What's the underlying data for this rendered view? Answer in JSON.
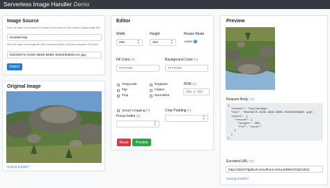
{
  "navbar": {
    "title": "Serverless Image Handler",
    "subtitle": "Demo"
  },
  "image_source": {
    "heading": "Image Source",
    "bucket_help": "Enter the name of an Amazon S3 bucket in your account that contains original image files.",
    "bucket_value": "bouldermap",
    "key_help": "Enter the name of an image file (with extension) stored in the above Amazon S3 bucket.",
    "key_value": "D6249275-AC6D-4B4D-B4BC-E833093EBAAC.jpg",
    "import_label": "Import"
  },
  "original_image": {
    "heading": "Original Image",
    "trouble_link": "Having trouble?"
  },
  "editor": {
    "heading": "Editor",
    "width_label": "Width",
    "width_value": "200",
    "height_label": "Height",
    "height_value": "300",
    "resize_label": "Resize Mode",
    "resize_value": "cover",
    "fill_label": "Fill Color",
    "fill_link": "(?)",
    "fill_placeholder": "#FF0000",
    "bg_label": "Background Color",
    "bg_link": "(?)",
    "bg_placeholder": "#FF0000",
    "checks": [
      "Grayscale",
      "Flip",
      "Flop",
      "Negative",
      "Flatten",
      "Normalize"
    ],
    "rgb_label": "RGB",
    "rgb_link": "(?)",
    "rgb_placeholder": "255, 0, 255",
    "smart_crop_label": "Smart Cropping",
    "smart_crop_link": "(?)",
    "focus_label": "Focus Index",
    "focus_link": "(?)",
    "crop_pad_label": "Crop Padding",
    "crop_pad_link": "(?)",
    "reset_label": "Reset",
    "preview_label": "Preview"
  },
  "preview": {
    "heading": "Preview",
    "request_label": "Request Body:",
    "request_link": "(?)",
    "request_body": "{\n  \"bucket\": \"bouldermap\",\n  \"key\": \"D6249275-AC6D-4B4D-B4BC-E833093EBAAC.jpg\",\n  \"edits\": {\n    \"resize\": {\n      \"height\": 300,\n      \"fit\": \"cover\"\n    }\n  }\n}",
    "url_label": "Encoded URL:",
    "url_link": "(?)",
    "url_value": "https://d2afv7fgdko3r.cloudfront.net/eyJidWNrZXQiOiJib3",
    "trouble_link": "Having trouble?"
  },
  "colors": {
    "primary": "#1f7bd8",
    "danger": "#dc3545",
    "success": "#28a745",
    "navbar": "#343a40"
  }
}
